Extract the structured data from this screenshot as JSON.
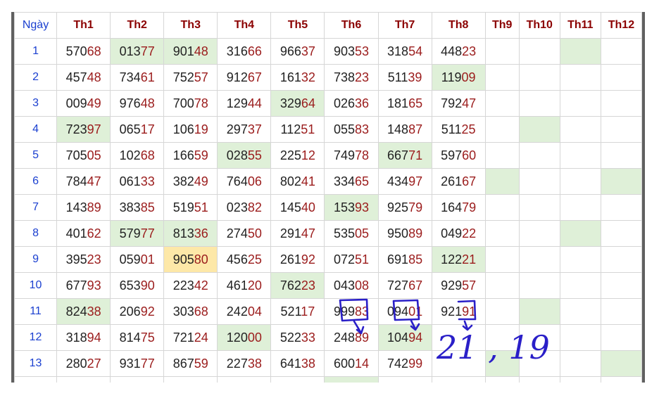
{
  "header": {
    "day_col": "Ngày",
    "months": [
      "Th1",
      "Th2",
      "Th3",
      "Th4",
      "Th5",
      "Th6",
      "Th7",
      "Th8",
      "Th9",
      "Th10",
      "Th11",
      "Th12"
    ]
  },
  "rows": [
    {
      "day": "1",
      "cells": [
        [
          "570",
          "68"
        ],
        [
          "013",
          "77"
        ],
        [
          "901",
          "48"
        ],
        [
          "316",
          "66"
        ],
        [
          "966",
          "37"
        ],
        [
          "903",
          "53"
        ],
        [
          "318",
          "54"
        ],
        [
          "448",
          "23"
        ],
        [
          "",
          ""
        ],
        [
          "",
          ""
        ],
        [
          "",
          ""
        ],
        [
          "",
          ""
        ]
      ]
    },
    {
      "day": "2",
      "cells": [
        [
          "457",
          "48"
        ],
        [
          "734",
          "61"
        ],
        [
          "752",
          "57"
        ],
        [
          "912",
          "67"
        ],
        [
          "161",
          "32"
        ],
        [
          "738",
          "23"
        ],
        [
          "511",
          "39"
        ],
        [
          "119",
          "09"
        ],
        [
          "",
          ""
        ],
        [
          "",
          ""
        ],
        [
          "",
          ""
        ],
        [
          "",
          ""
        ]
      ]
    },
    {
      "day": "3",
      "cells": [
        [
          "009",
          "49"
        ],
        [
          "976",
          "48"
        ],
        [
          "700",
          "78"
        ],
        [
          "129",
          "44"
        ],
        [
          "329",
          "64"
        ],
        [
          "026",
          "36"
        ],
        [
          "181",
          "65"
        ],
        [
          "792",
          "47"
        ],
        [
          "",
          ""
        ],
        [
          "",
          ""
        ],
        [
          "",
          ""
        ],
        [
          "",
          ""
        ]
      ]
    },
    {
      "day": "4",
      "cells": [
        [
          "723",
          "97"
        ],
        [
          "065",
          "17"
        ],
        [
          "106",
          "19"
        ],
        [
          "297",
          "37"
        ],
        [
          "112",
          "51"
        ],
        [
          "055",
          "83"
        ],
        [
          "148",
          "87"
        ],
        [
          "511",
          "25"
        ],
        [
          "",
          ""
        ],
        [
          "",
          ""
        ],
        [
          "",
          ""
        ],
        [
          "",
          ""
        ]
      ]
    },
    {
      "day": "5",
      "cells": [
        [
          "705",
          "05"
        ],
        [
          "102",
          "68"
        ],
        [
          "166",
          "59"
        ],
        [
          "028",
          "55"
        ],
        [
          "225",
          "12"
        ],
        [
          "749",
          "78"
        ],
        [
          "667",
          "71"
        ],
        [
          "597",
          "60"
        ],
        [
          "",
          ""
        ],
        [
          "",
          ""
        ],
        [
          "",
          ""
        ],
        [
          "",
          ""
        ]
      ]
    },
    {
      "day": "6",
      "cells": [
        [
          "784",
          "47"
        ],
        [
          "061",
          "33"
        ],
        [
          "382",
          "49"
        ],
        [
          "764",
          "06"
        ],
        [
          "802",
          "41"
        ],
        [
          "334",
          "65"
        ],
        [
          "434",
          "97"
        ],
        [
          "261",
          "67"
        ],
        [
          "",
          ""
        ],
        [
          "",
          ""
        ],
        [
          "",
          ""
        ],
        [
          "",
          ""
        ]
      ]
    },
    {
      "day": "7",
      "cells": [
        [
          "143",
          "89"
        ],
        [
          "383",
          "85"
        ],
        [
          "519",
          "51"
        ],
        [
          "023",
          "82"
        ],
        [
          "145",
          "40"
        ],
        [
          "153",
          "93"
        ],
        [
          "925",
          "79"
        ],
        [
          "164",
          "79"
        ],
        [
          "",
          ""
        ],
        [
          "",
          ""
        ],
        [
          "",
          ""
        ],
        [
          "",
          ""
        ]
      ]
    },
    {
      "day": "8",
      "cells": [
        [
          "401",
          "62"
        ],
        [
          "579",
          "77"
        ],
        [
          "813",
          "36"
        ],
        [
          "274",
          "50"
        ],
        [
          "291",
          "47"
        ],
        [
          "535",
          "05"
        ],
        [
          "950",
          "89"
        ],
        [
          "049",
          "22"
        ],
        [
          "",
          ""
        ],
        [
          "",
          ""
        ],
        [
          "",
          ""
        ],
        [
          "",
          ""
        ]
      ]
    },
    {
      "day": "9",
      "cells": [
        [
          "395",
          "23"
        ],
        [
          "059",
          "01"
        ],
        [
          "905",
          "80"
        ],
        [
          "456",
          "25"
        ],
        [
          "261",
          "92"
        ],
        [
          "072",
          "51"
        ],
        [
          "691",
          "85"
        ],
        [
          "122",
          "21"
        ],
        [
          "",
          ""
        ],
        [
          "",
          ""
        ],
        [
          "",
          ""
        ],
        [
          "",
          ""
        ]
      ]
    },
    {
      "day": "10",
      "cells": [
        [
          "677",
          "93"
        ],
        [
          "653",
          "90"
        ],
        [
          "223",
          "42"
        ],
        [
          "461",
          "20"
        ],
        [
          "762",
          "23"
        ],
        [
          "043",
          "08"
        ],
        [
          "727",
          "67"
        ],
        [
          "929",
          "57"
        ],
        [
          "",
          ""
        ],
        [
          "",
          ""
        ],
        [
          "",
          ""
        ],
        [
          "",
          ""
        ]
      ]
    },
    {
      "day": "11",
      "cells": [
        [
          "824",
          "38"
        ],
        [
          "206",
          "92"
        ],
        [
          "303",
          "68"
        ],
        [
          "242",
          "04"
        ],
        [
          "521",
          "17"
        ],
        [
          "999",
          "83"
        ],
        [
          "094",
          "01"
        ],
        [
          "921",
          "91"
        ],
        [
          "",
          ""
        ],
        [
          "",
          ""
        ],
        [
          "",
          ""
        ],
        [
          "",
          ""
        ]
      ]
    },
    {
      "day": "12",
      "cells": [
        [
          "318",
          "94"
        ],
        [
          "814",
          "75"
        ],
        [
          "721",
          "24"
        ],
        [
          "120",
          "00"
        ],
        [
          "522",
          "33"
        ],
        [
          "248",
          "89"
        ],
        [
          "104",
          "94"
        ],
        [
          "",
          ""
        ],
        [
          "",
          ""
        ],
        [
          "",
          ""
        ],
        [
          "",
          ""
        ],
        [
          "",
          ""
        ]
      ]
    },
    {
      "day": "13",
      "cells": [
        [
          "280",
          "27"
        ],
        [
          "931",
          "77"
        ],
        [
          "867",
          "59"
        ],
        [
          "227",
          "38"
        ],
        [
          "641",
          "38"
        ],
        [
          "600",
          "14"
        ],
        [
          "742",
          "99"
        ],
        [
          "",
          ""
        ],
        [
          "",
          ""
        ],
        [
          "",
          ""
        ],
        [
          "",
          ""
        ],
        [
          "",
          ""
        ]
      ]
    },
    {
      "day": "",
      "cells": [
        [
          "",
          ""
        ],
        [
          "",
          ""
        ],
        [
          "",
          ""
        ],
        [
          "",
          ""
        ],
        [
          "",
          ""
        ],
        [
          "",
          ""
        ],
        [
          "",
          ""
        ],
        [
          "",
          ""
        ],
        [
          "",
          ""
        ],
        [
          "",
          ""
        ],
        [
          "",
          ""
        ],
        [
          "",
          ""
        ]
      ]
    }
  ],
  "highlights": {
    "green": [
      [
        0,
        1
      ],
      [
        0,
        2
      ],
      [
        0,
        10
      ],
      [
        1,
        7
      ],
      [
        2,
        4
      ],
      [
        3,
        0
      ],
      [
        3,
        9
      ],
      [
        4,
        3
      ],
      [
        4,
        6
      ],
      [
        5,
        8
      ],
      [
        5,
        11
      ],
      [
        6,
        5
      ],
      [
        7,
        1
      ],
      [
        7,
        2
      ],
      [
        7,
        10
      ],
      [
        8,
        7
      ],
      [
        9,
        4
      ],
      [
        10,
        0
      ],
      [
        10,
        9
      ],
      [
        11,
        3
      ],
      [
        11,
        6
      ],
      [
        12,
        8
      ],
      [
        12,
        11
      ],
      [
        13,
        5
      ]
    ],
    "yellow": [
      [
        8,
        2
      ]
    ]
  },
  "annotation": {
    "text": "21 , 19",
    "ink_color": "#2a1fc8"
  }
}
